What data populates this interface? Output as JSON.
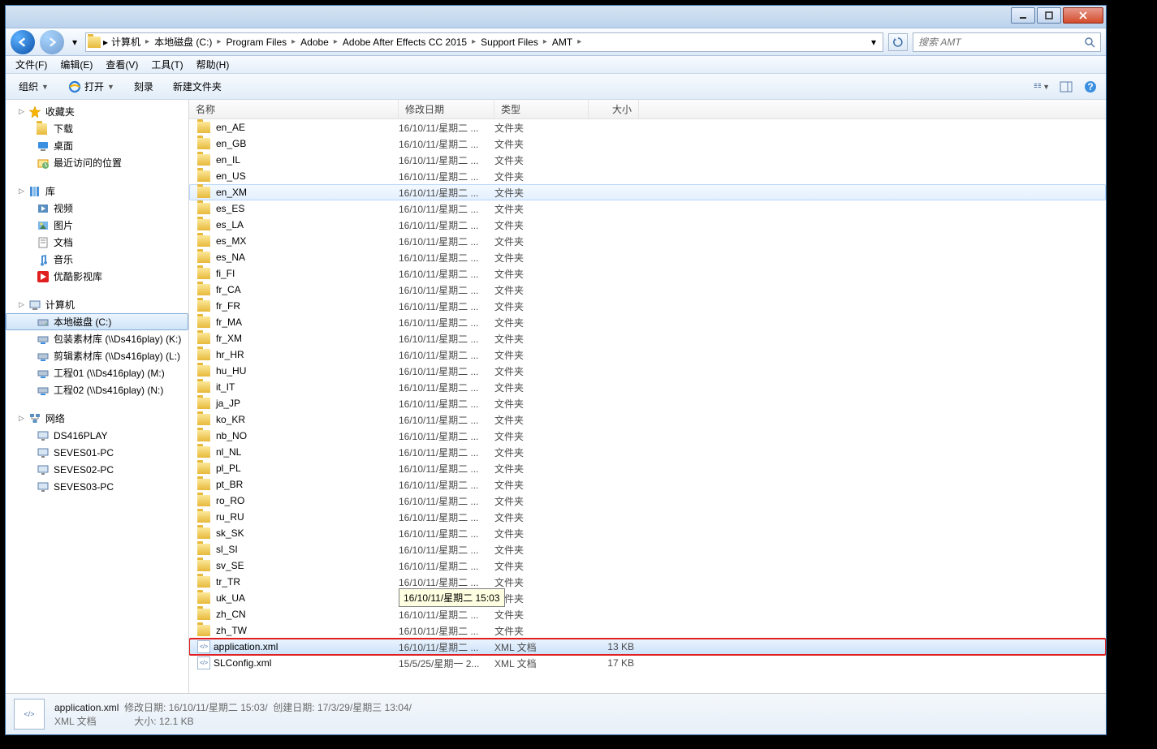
{
  "breadcrumbs": [
    "计算机",
    "本地磁盘 (C:)",
    "Program Files",
    "Adobe",
    "Adobe After Effects CC 2015",
    "Support Files",
    "AMT"
  ],
  "search_placeholder": "搜索 AMT",
  "menu": [
    "文件(F)",
    "编辑(E)",
    "查看(V)",
    "工具(T)",
    "帮助(H)"
  ],
  "toolbar": {
    "organize": "组织",
    "open": "打开",
    "burn": "刻录",
    "newfolder": "新建文件夹"
  },
  "columns": {
    "name": "名称",
    "date": "修改日期",
    "type": "类型",
    "size": "大小"
  },
  "sidebar": {
    "favorites": {
      "label": "收藏夹",
      "items": [
        {
          "k": "downloads",
          "label": "下载"
        },
        {
          "k": "desktop",
          "label": "桌面"
        },
        {
          "k": "recent",
          "label": "最近访问的位置"
        }
      ]
    },
    "library": {
      "label": "库",
      "items": [
        {
          "k": "video",
          "label": "视频"
        },
        {
          "k": "pictures",
          "label": "图片"
        },
        {
          "k": "documents",
          "label": "文档"
        },
        {
          "k": "music",
          "label": "音乐"
        },
        {
          "k": "youku",
          "label": "优酷影视库"
        }
      ]
    },
    "computer": {
      "label": "计算机",
      "items": [
        {
          "k": "cdrive",
          "label": "本地磁盘 (C:)",
          "sel": true
        },
        {
          "k": "k",
          "label": "包装素材库 (\\\\Ds416play) (K:)"
        },
        {
          "k": "l",
          "label": "剪辑素材库 (\\\\Ds416play) (L:)"
        },
        {
          "k": "m",
          "label": "工程01 (\\\\Ds416play) (M:)"
        },
        {
          "k": "n",
          "label": "工程02 (\\\\Ds416play) (N:)"
        }
      ]
    },
    "network": {
      "label": "网络",
      "items": [
        {
          "k": "ds",
          "label": "DS416PLAY"
        },
        {
          "k": "s1",
          "label": "SEVES01-PC"
        },
        {
          "k": "s2",
          "label": "SEVES02-PC"
        },
        {
          "k": "s3",
          "label": "SEVES03-PC"
        }
      ]
    }
  },
  "file_date": "16/10/11/星期二 ...",
  "folder_type": "文件夹",
  "xml_type": "XML 文档",
  "folders": [
    "en_AE",
    "en_GB",
    "en_IL",
    "en_US",
    "en_XM",
    "es_ES",
    "es_LA",
    "es_MX",
    "es_NA",
    "fi_FI",
    "fr_CA",
    "fr_FR",
    "fr_MA",
    "fr_XM",
    "hr_HR",
    "hu_HU",
    "it_IT",
    "ja_JP",
    "ko_KR",
    "nb_NO",
    "nl_NL",
    "pl_PL",
    "pt_BR",
    "ro_RO",
    "ru_RU",
    "sk_SK",
    "sl_SI",
    "sv_SE",
    "tr_TR",
    "uk_UA",
    "zh_CN",
    "zh_TW"
  ],
  "hover_folder": "en_XM",
  "files": [
    {
      "name": "application.xml",
      "date": "16/10/11/星期二 ...",
      "type": "XML 文档",
      "size": "13 KB",
      "sel": true,
      "hl": true
    },
    {
      "name": "SLConfig.xml",
      "date": "15/5/25/星期一 2...",
      "type": "XML 文档",
      "size": "17 KB"
    }
  ],
  "tooltip": {
    "text": "16/10/11/星期二 15:03",
    "target": "uk_UA"
  },
  "details": {
    "name": "application.xml",
    "line1a": "修改日期: 16/10/11/星期二 15:03/",
    "line1b": "创建日期: 17/3/29/星期三 13:04/",
    "line2a": "XML 文档",
    "line2b": "大小: 12.1 KB"
  }
}
